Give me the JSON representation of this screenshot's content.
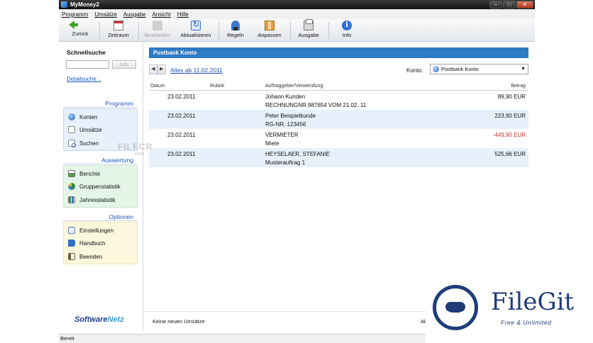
{
  "window": {
    "title": "MyMoney2"
  },
  "window_controls": {
    "minimize": "–",
    "maximize": "□",
    "close": "✕"
  },
  "menu": [
    "Programm",
    "Umsätze",
    "Ausgabe",
    "Ansicht",
    "Hilfe"
  ],
  "toolbar": {
    "back": "Zurück",
    "period": "Zeitraum",
    "edit": "Bearbeiten",
    "refresh": "Aktualisieren",
    "rules": "Regeln",
    "adjust": "Anpassen",
    "output": "Ausgabe",
    "info": "Info",
    "info_glyph": "i"
  },
  "sidebar": {
    "quicksearch_title": "Schnellsuche",
    "quicksearch_go": "Los",
    "quicksearch_detail": "Detailsuche...",
    "groups": {
      "programm": {
        "title": "Programm",
        "items": [
          "Konten",
          "Umsätze",
          "Suchen"
        ]
      },
      "auswertung": {
        "title": "Auswertung",
        "items": [
          "Berichte",
          "Gruppenstatistik",
          "Jahresstatistik"
        ]
      },
      "optionen": {
        "title": "Optionen",
        "items": [
          "Einstellungen",
          "Handbuch",
          "Beenden"
        ]
      }
    },
    "brand_main": "Software",
    "brand_accent": "Netz"
  },
  "main": {
    "panel_title": "Postbank Konto",
    "period_link": "Alles ab 11.02.2011",
    "konto_label": "Konto:",
    "konto_value": "Postbank Konto",
    "columns": [
      "Datum",
      "Rubrik",
      "Auftraggeber/Verwendung",
      "Betrag"
    ],
    "rows": [
      {
        "date": "23.02.2011",
        "name": "Johann Kunden",
        "purpose": "RECHNUNGNR.987654 VOM 21.02. 11",
        "amount": "89,90 EUR"
      },
      {
        "date": "23.02.2011",
        "name": "Peter Beispielkunde",
        "purpose": "RG-NR. 123456",
        "amount": "223,90 EUR"
      },
      {
        "date": "23.02.2011",
        "name": "VERMIETER",
        "purpose": "Miete",
        "amount": "-449,90 EUR"
      },
      {
        "date": "23.02.2011",
        "name": "HEYSELAER, STEFANIE",
        "purpose": "Musterauftrag 1",
        "amount": "525,66 EUR"
      }
    ],
    "status_left": "Keine neuen Umsätze",
    "status_right": "Akt"
  },
  "statusbar": {
    "text": "Bereit"
  },
  "watermarks": {
    "filecr": "FILECR",
    "filecr_sub": ".com",
    "filegit_name": "FileGit",
    "filegit_tag": "Free & Unlimited"
  },
  "colors": {
    "panel_header": "#2e7bc4",
    "link": "#1f55b9",
    "negative": "#c0392b",
    "alt_row": "#e8f0fb"
  }
}
